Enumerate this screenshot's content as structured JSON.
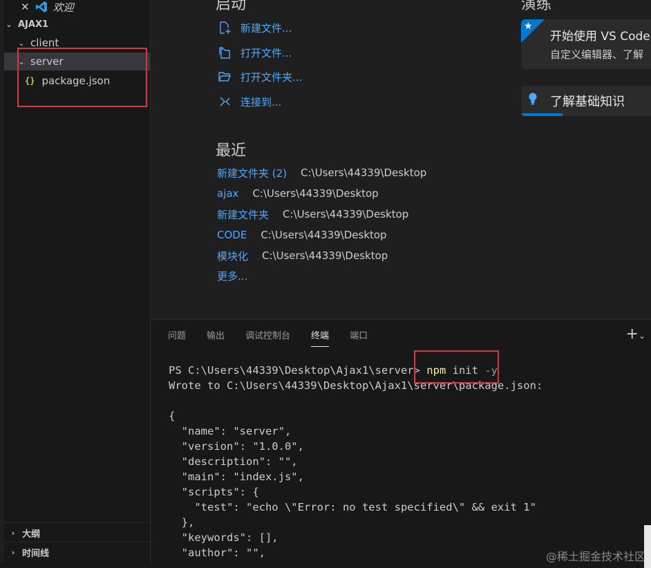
{
  "explorer": {
    "open_editor_title": "欢迎",
    "root": "AJAX1",
    "folders": [
      "client",
      "server"
    ],
    "file": "package.json",
    "outline": "大纲",
    "timeline": "时间线"
  },
  "welcome": {
    "start_heading": "启动",
    "walkthrough_heading": "演练",
    "actions": [
      {
        "label": "新建文件...",
        "icon": "new-file-icon"
      },
      {
        "label": "打开文件...",
        "icon": "open-file-icon"
      },
      {
        "label": "打开文件夹...",
        "icon": "open-folder-icon"
      },
      {
        "label": "连接到...",
        "icon": "remote-connect-icon"
      }
    ],
    "recent_heading": "最近",
    "recent": [
      {
        "name": "新建文件夹 (2)",
        "path": "C:\\Users\\44339\\Desktop"
      },
      {
        "name": "ajax",
        "path": "C:\\Users\\44339\\Desktop"
      },
      {
        "name": "新建文件夹",
        "path": "C:\\Users\\44339\\Desktop"
      },
      {
        "name": "CODE",
        "path": "C:\\Users\\44339\\Desktop"
      },
      {
        "name": "模块化",
        "path": "C:\\Users\\44339\\Desktop"
      }
    ],
    "more": "更多...",
    "card_get_started_title": "开始使用 VS Code",
    "card_get_started_desc": "自定义编辑器、了解",
    "card_fundamentals_title": "了解基础知识"
  },
  "panel": {
    "tabs": [
      "问题",
      "输出",
      "调试控制台",
      "终端",
      "端口"
    ],
    "active_tab": "终端",
    "terminal": {
      "prompt": "PS C:\\Users\\44339\\Desktop\\Ajax1\\server>",
      "cmd_npm": "npm",
      "cmd_init": "init",
      "cmd_flag": "-y",
      "lines": [
        "Wrote to C:\\Users\\44339\\Desktop\\Ajax1\\server\\package.json:",
        "",
        "{",
        "  \"name\": \"server\",",
        "  \"version\": \"1.0.0\",",
        "  \"description\": \"\",",
        "  \"main\": \"index.js\",",
        "  \"scripts\": {",
        "    \"test\": \"echo \\\"Error: no test specified\\\" && exit 1\"",
        "  },",
        "  \"keywords\": [],",
        "  \"author\": \"\","
      ]
    }
  },
  "watermark": "@稀土掘金技术社区",
  "colors": {
    "accent": "#0078d4",
    "link": "#4daafc",
    "highlight_box": "#e0353a"
  }
}
